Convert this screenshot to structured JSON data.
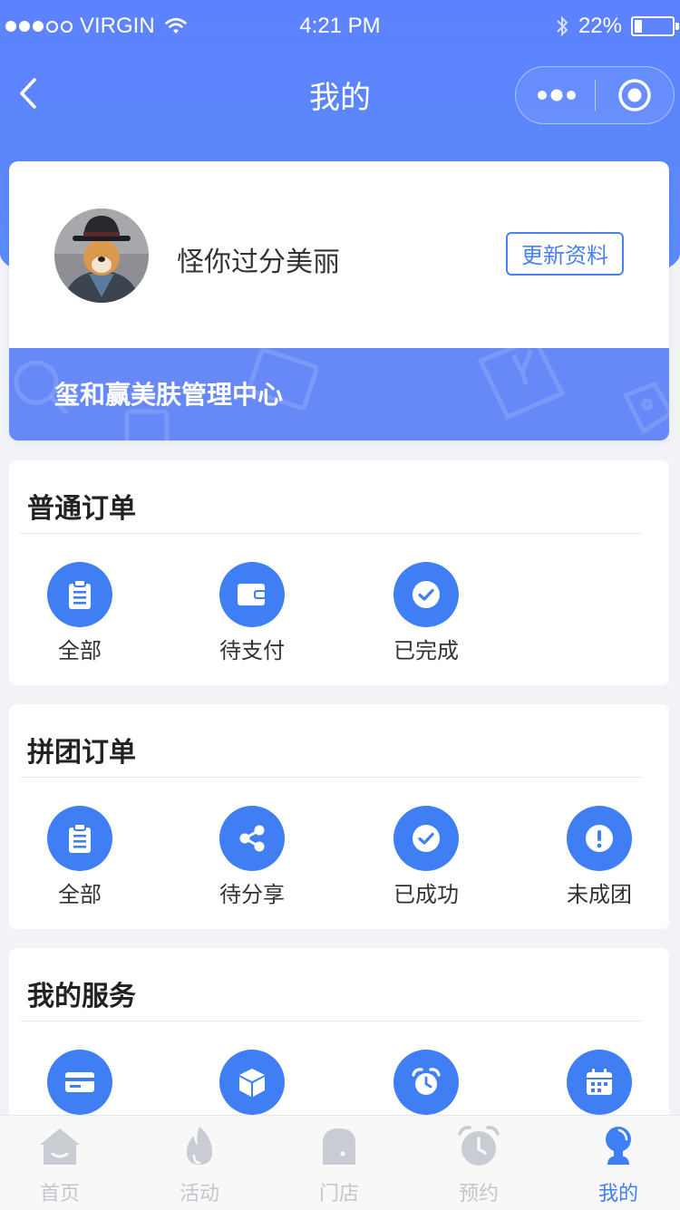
{
  "status_bar": {
    "carrier": "VIRGIN",
    "time": "4:21 PM",
    "battery": "22%",
    "battery_level": 0.22
  },
  "nav": {
    "title": "我的"
  },
  "profile": {
    "username": "怪你过分美丽",
    "update_button": "更新资料",
    "center_name": "玺和赢美肤管理中心"
  },
  "orders": {
    "title": "普通订单",
    "items": [
      {
        "label": "全部",
        "icon": "clipboard-icon"
      },
      {
        "label": "待支付",
        "icon": "wallet-icon"
      },
      {
        "label": "已完成",
        "icon": "check-circle-icon"
      }
    ]
  },
  "group_orders": {
    "title": "拼团订单",
    "items": [
      {
        "label": "全部",
        "icon": "clipboard-icon"
      },
      {
        "label": "待分享",
        "icon": "share-icon"
      },
      {
        "label": "已成功",
        "icon": "check-circle-icon"
      },
      {
        "label": "未成团",
        "icon": "alert-icon"
      }
    ]
  },
  "services": {
    "title": "我的服务",
    "items": [
      {
        "icon": "card-icon"
      },
      {
        "icon": "box-icon"
      },
      {
        "icon": "alarm-icon"
      },
      {
        "icon": "calendar-icon"
      }
    ]
  },
  "tabbar": {
    "items": [
      {
        "label": "首页",
        "icon": "home-icon"
      },
      {
        "label": "活动",
        "icon": "fire-icon"
      },
      {
        "label": "门店",
        "icon": "store-icon"
      },
      {
        "label": "预约",
        "icon": "clock-icon"
      },
      {
        "label": "我的",
        "icon": "user-icon"
      }
    ],
    "active_index": 4
  },
  "colors": {
    "primary": "#3f7ff3",
    "header_gradient_top": "#5d82ff",
    "center_bar": "#6689f7",
    "tab_inactive": "#c4c6cc"
  }
}
